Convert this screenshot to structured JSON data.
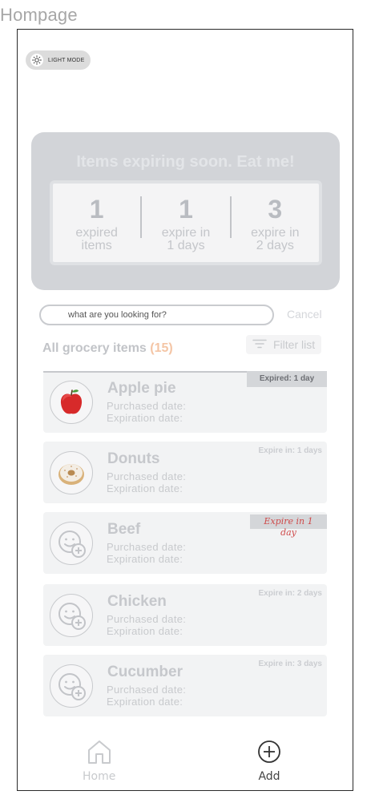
{
  "page": {
    "label": "Hompage"
  },
  "mode_toggle": {
    "label": "LIGHT MODE",
    "icon": "sun-icon"
  },
  "summary": {
    "title": "Items expiring soon. Eat me!",
    "stats": [
      {
        "value": "1",
        "label_line1": "expired",
        "label_line2": "items"
      },
      {
        "value": "1",
        "label_line1": "expire in",
        "label_line2": "1 days"
      },
      {
        "value": "3",
        "label_line1": "expire in",
        "label_line2": "2 days"
      }
    ]
  },
  "search": {
    "placeholder": "what are you looking for?",
    "cancel_label": "Cancel"
  },
  "list": {
    "title": "All grocery items",
    "count": "(15)",
    "filter_label": "Filter list"
  },
  "items": [
    {
      "name": "Apple pie",
      "purchased_label": "Purchased date:",
      "expiration_label": "Expiration date:",
      "badge": "Expired: 1 day",
      "icon": "apple-icon"
    },
    {
      "name": "Donuts",
      "purchased_label": "Purchased date:",
      "expiration_label": "Expiration date:",
      "badge": "Expire in: 1 days",
      "icon": "donut-icon"
    },
    {
      "name": "Beef",
      "purchased_label": "Purchased date:",
      "expiration_label": "Expiration date:",
      "badge": "Expire in 1 day",
      "icon": "face-add-icon"
    },
    {
      "name": "Chicken",
      "purchased_label": "Purchased date:",
      "expiration_label": "Expiration date:",
      "badge": "Expire in: 2 days",
      "icon": "face-add-icon"
    },
    {
      "name": "Cucumber",
      "purchased_label": "Purchased date:",
      "expiration_label": "Expiration date:",
      "badge": "Expire in: 3 days",
      "icon": "face-add-icon"
    }
  ],
  "nav": {
    "home_label": "Home",
    "add_label": "Add"
  },
  "colors": {
    "accent_count": "#f4c5a5",
    "alert_text": "#cf4a4a",
    "card_bg": "#d2d4d8"
  }
}
